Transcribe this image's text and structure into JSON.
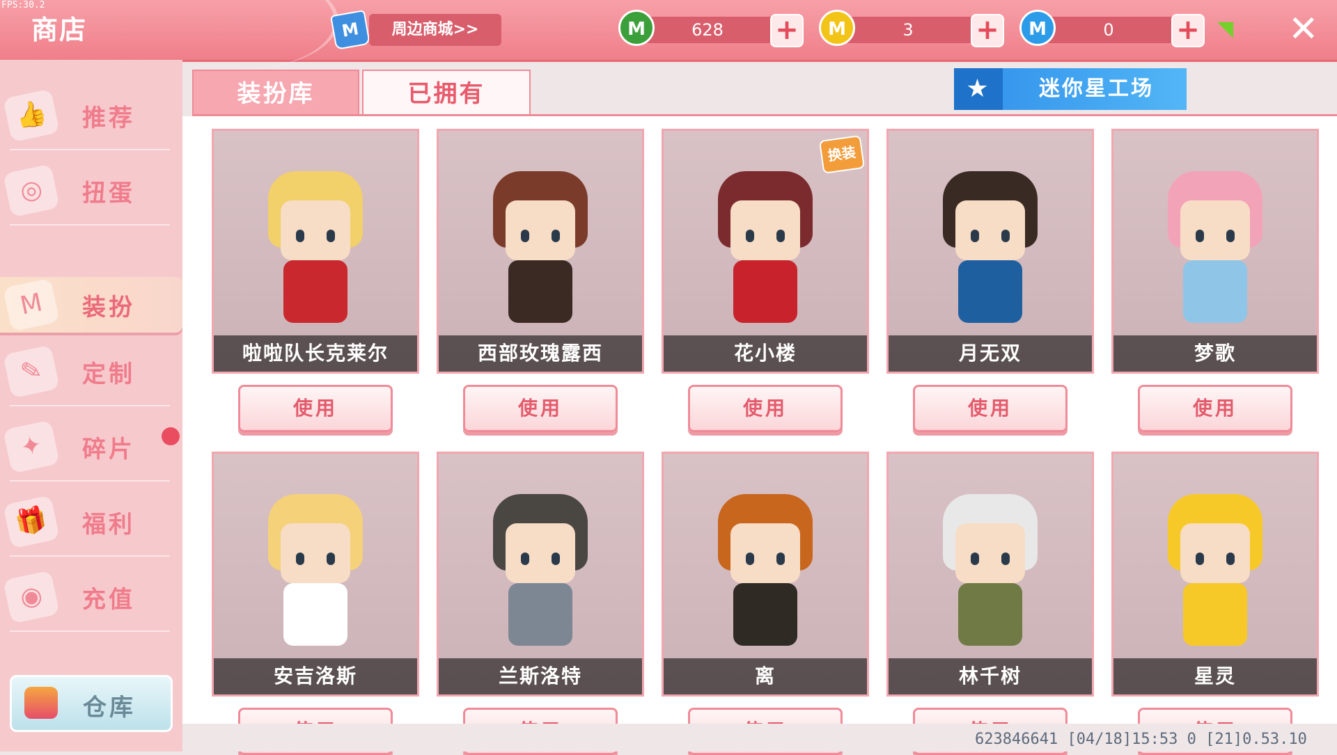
{
  "fps": "FPS:30.2",
  "header": {
    "title": "商店",
    "mall_label": "周边商城>>",
    "mall_icon": "M",
    "close": "✕"
  },
  "currencies": [
    {
      "value": "628",
      "icon": "M",
      "color": "#3ca03a"
    },
    {
      "value": "3",
      "icon": "M",
      "color": "#f3c418"
    },
    {
      "value": "0",
      "icon": "M",
      "color": "#2c9be8"
    }
  ],
  "sidebar": {
    "items": [
      {
        "label": "推荐",
        "icon": "thumbs-up-icon",
        "glyph": "👍"
      },
      {
        "label": "扭蛋",
        "icon": "capsule-icon",
        "glyph": "◎"
      },
      {
        "label": "装扮",
        "icon": "shirt-icon",
        "glyph": "M"
      },
      {
        "label": "定制",
        "icon": "pencil-icon",
        "glyph": "✎"
      },
      {
        "label": "碎片",
        "icon": "fragment-icon",
        "glyph": "✦"
      },
      {
        "label": "福利",
        "icon": "gift-icon",
        "glyph": "🎁"
      },
      {
        "label": "充值",
        "icon": "coins-icon",
        "glyph": "◉"
      }
    ],
    "active_index": 2,
    "warehouse_label": "仓库"
  },
  "tabs": [
    {
      "label": "装扮库"
    },
    {
      "label": "已拥有"
    }
  ],
  "active_tab": 1,
  "workshop_label": "迷你星工场",
  "workshop_icon": "★",
  "use_label": "使用",
  "costume_tag": "换装",
  "characters": [
    {
      "name": "啦啦队长克莱尔",
      "hair": "#f2d06a",
      "body": "#c8282e"
    },
    {
      "name": "西部玫瑰露西",
      "hair": "#7a3b2a",
      "body": "#3b2a24"
    },
    {
      "name": "花小楼",
      "hair": "#7b2a2e",
      "body": "#c8232d"
    },
    {
      "name": "月无双",
      "hair": "#3a2a24",
      "body": "#1e5fa0"
    },
    {
      "name": "梦歌",
      "hair": "#f2a3b8",
      "body": "#8fc6e8"
    },
    {
      "name": "安吉洛斯",
      "hair": "#f5d17a",
      "body": "#ffffff"
    },
    {
      "name": "兰斯洛特",
      "hair": "#4a4642",
      "body": "#7d8794"
    },
    {
      "name": "离",
      "hair": "#c8661e",
      "body": "#2f2a24"
    },
    {
      "name": "林千树",
      "hair": "#e8e8e8",
      "body": "#6f7a45"
    },
    {
      "name": "星灵",
      "hair": "#f7c928",
      "body": "#f7c928"
    }
  ],
  "footer": "623846641   [04/18]15:53 0  [21]0.53.10"
}
